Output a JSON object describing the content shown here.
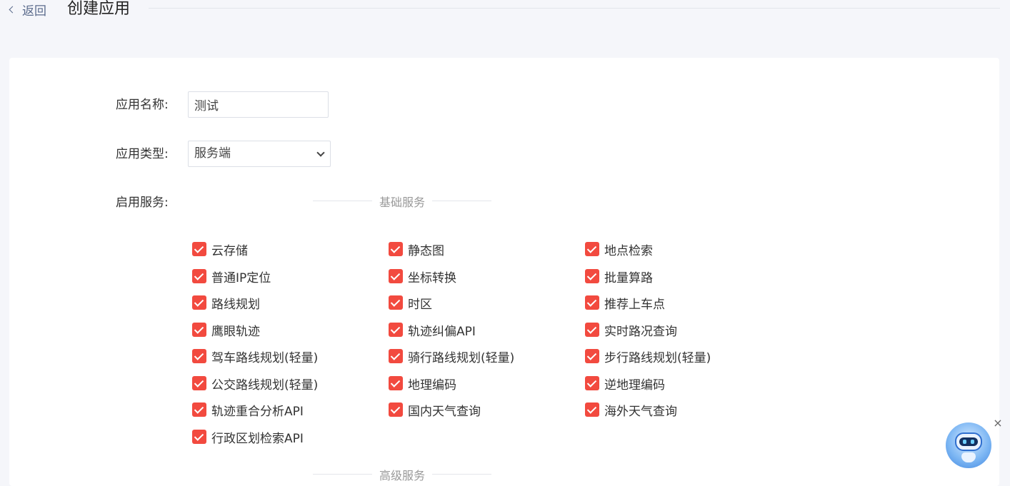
{
  "header": {
    "back_label": "返回",
    "title": "创建应用"
  },
  "form": {
    "name_label": "应用名称:",
    "name_value": "测试",
    "type_label": "应用类型:",
    "type_value": "服务端",
    "services_label": "启用服务:"
  },
  "sections": {
    "basic_title": "基础服务",
    "advanced_title": "高级服务"
  },
  "services": [
    [
      "云存储",
      "静态图",
      "地点检索"
    ],
    [
      "普通IP定位",
      "坐标转换",
      "批量算路"
    ],
    [
      "路线规划",
      "时区",
      "推荐上车点"
    ],
    [
      "鹰眼轨迹",
      "轨迹纠偏API",
      "实时路况查询"
    ],
    [
      "驾车路线规划(轻量)",
      "骑行路线规划(轻量)",
      "步行路线规划(轻量)"
    ],
    [
      "公交路线规划(轻量)",
      "地理编码",
      "逆地理编码"
    ],
    [
      "轨迹重合分析API",
      "国内天气查询",
      "海外天气查询"
    ],
    [
      "行政区划检索API"
    ]
  ],
  "assistant": {
    "close_glyph": "×"
  },
  "colors": {
    "accent": "#f24a3f",
    "background": "#f5f6fa",
    "card": "#ffffff"
  }
}
